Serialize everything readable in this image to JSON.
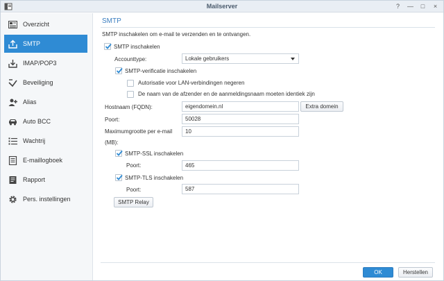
{
  "window": {
    "title": "Mailserver",
    "controls": [
      {
        "name": "help-button",
        "glyph": "?"
      },
      {
        "name": "minimize-button",
        "glyph": "—"
      },
      {
        "name": "maximize-button",
        "glyph": "□"
      },
      {
        "name": "close-button",
        "glyph": "×"
      }
    ]
  },
  "sidebar": {
    "items": [
      {
        "label": "Overzicht",
        "icon": "overview-icon",
        "active": false
      },
      {
        "label": "SMTP",
        "icon": "smtp-upload-icon",
        "active": true
      },
      {
        "label": "IMAP/POP3",
        "icon": "inbox-download-icon",
        "active": false
      },
      {
        "label": "Beveiliging",
        "icon": "shield-icon",
        "active": false
      },
      {
        "label": "Alias",
        "icon": "user-plus-icon",
        "active": false
      },
      {
        "label": "Auto BCC",
        "icon": "car-icon",
        "active": false
      },
      {
        "label": "Wachtrij",
        "icon": "queue-list-icon",
        "active": false
      },
      {
        "label": "E-maillogboek",
        "icon": "log-book-icon",
        "active": false
      },
      {
        "label": "Rapport",
        "icon": "report-icon",
        "active": false
      },
      {
        "label": "Pers. instellingen",
        "icon": "gear-icon",
        "active": false
      }
    ]
  },
  "main": {
    "title": "SMTP",
    "description": "SMTP inschakelen om e-mail te verzenden en te ontvangen.",
    "enable_smtp": {
      "label": "SMTP inschakelen",
      "checked": true
    },
    "account_type": {
      "label": "Accounttype:",
      "value": "Lokale gebruikers"
    },
    "smtp_auth": {
      "label": "SMTP-verificatie inschakelen",
      "checked": true
    },
    "ignore_lan": {
      "label": "Autorisatie voor LAN-verbindingen negeren",
      "checked": false
    },
    "same_sender": {
      "label": "De naam van de afzender en de aanmeldingsnaam moeten identiek zijn",
      "checked": false
    },
    "hostname": {
      "label": "Hostnaam (FQDN):",
      "value": "eigendomein.nl",
      "extra_button": "Extra domein"
    },
    "port": {
      "label": "Poort:",
      "value": "50028"
    },
    "max_size": {
      "label_line1": "Maximumgrootte per e-mail",
      "label_line2": "(MB):",
      "value": "10"
    },
    "smtp_ssl": {
      "label": "SMTP-SSL inschakelen",
      "checked": true,
      "port_label": "Poort:",
      "port_value": "465"
    },
    "smtp_tls": {
      "label": "SMTP-TLS inschakelen",
      "checked": true,
      "port_label": "Poort:",
      "port_value": "587"
    },
    "relay_button": "SMTP Relay"
  },
  "footer": {
    "ok": "OK",
    "cancel": "Herstellen"
  },
  "colors": {
    "accent": "#2f8bd4",
    "title_text": "#4a5a6c",
    "section_title": "#3a7ec0"
  }
}
